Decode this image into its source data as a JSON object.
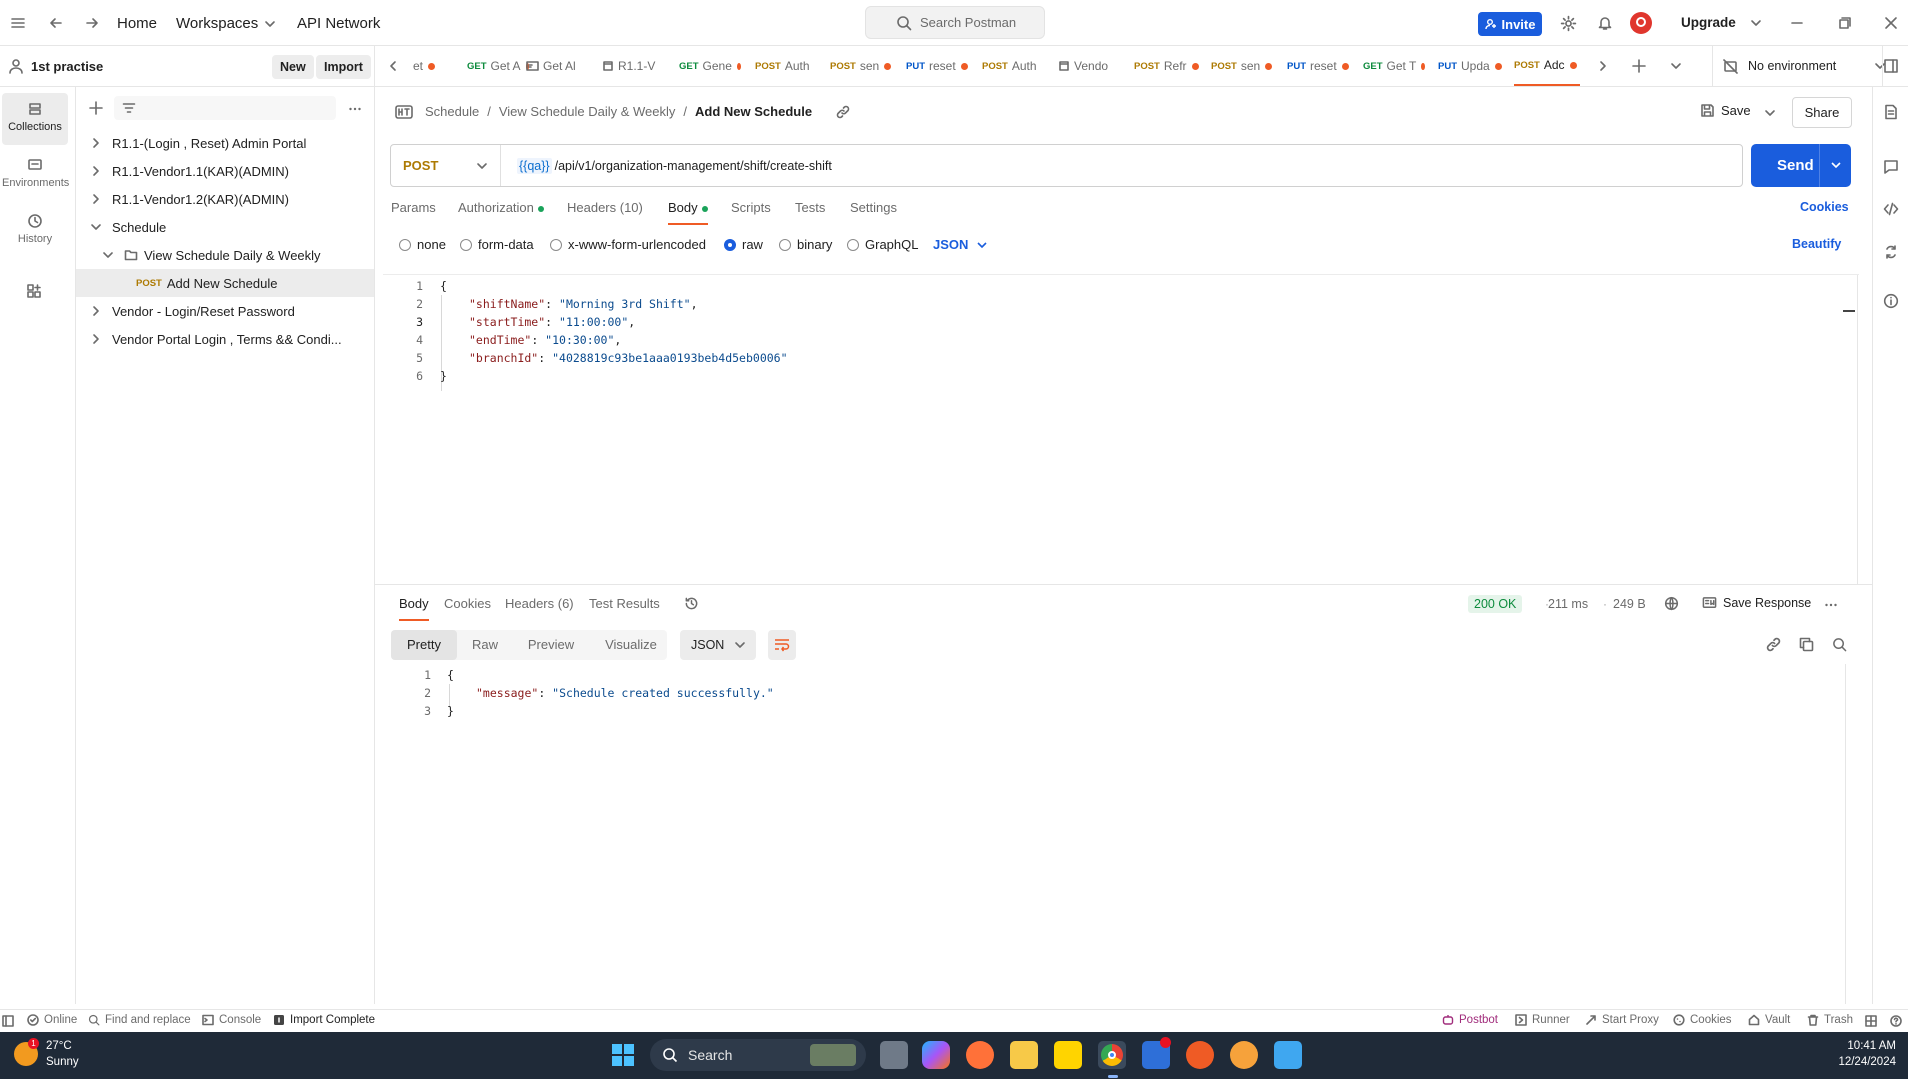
{
  "topbar": {
    "home": "Home",
    "workspaces": "Workspaces",
    "api_network": "API Network",
    "search_placeholder": "Search Postman",
    "invite": "Invite",
    "upgrade": "Upgrade"
  },
  "workspace": {
    "name": "1st practise",
    "new_label": "New",
    "import_label": "Import"
  },
  "rail": {
    "items": [
      {
        "label": "Collections",
        "icon": "collections-icon"
      },
      {
        "label": "Environments",
        "icon": "environments-icon"
      },
      {
        "label": "History",
        "icon": "history-icon"
      }
    ]
  },
  "sidebar": {
    "items": [
      {
        "label": "R1.1-(Login , Reset) Admin Portal"
      },
      {
        "label": "R1.1-Vendor1.1(KAR)(ADMIN)"
      },
      {
        "label": "R1.1-Vendor1.2(KAR)(ADMIN)"
      },
      {
        "label": "Schedule"
      },
      {
        "label": "View Schedule Daily & Weekly"
      },
      {
        "label": "Add New Schedule",
        "method": "POST"
      },
      {
        "label": "Vendor - Login/Reset Password"
      },
      {
        "label": "Vendor Portal Login , Terms && Condi..."
      }
    ]
  },
  "tabs": [
    {
      "method": "",
      "label": "et"
    },
    {
      "method": "GET",
      "label": "Get A"
    },
    {
      "method": "",
      "label": "Get Al"
    },
    {
      "method": "",
      "label": "R1.1-V"
    },
    {
      "method": "GET",
      "label": "Gene"
    },
    {
      "method": "POST",
      "label": "Auth"
    },
    {
      "method": "POST",
      "label": "sen"
    },
    {
      "method": "PUT",
      "label": "reset"
    },
    {
      "method": "POST",
      "label": "Auth"
    },
    {
      "method": "",
      "label": "Vendo"
    },
    {
      "method": "POST",
      "label": "Refr"
    },
    {
      "method": "POST",
      "label": "sen"
    },
    {
      "method": "PUT",
      "label": "reset"
    },
    {
      "method": "GET",
      "label": "Get T"
    },
    {
      "method": "PUT",
      "label": "Upda"
    },
    {
      "method": "POST",
      "label": "Adc"
    }
  ],
  "environment": "No environment",
  "breadcrumb": {
    "part1": "Schedule",
    "part2": "View Schedule Daily & Weekly",
    "current": "Add New Schedule"
  },
  "actions": {
    "save": "Save",
    "share": "Share"
  },
  "request": {
    "method": "POST",
    "url_var": "{{qa}}",
    "url_path": "/api/v1/organization-management/shift/create-shift",
    "send": "Send"
  },
  "request_tabs": {
    "params": "Params",
    "authorization": "Authorization",
    "headers": "Headers (10)",
    "body": "Body",
    "scripts": "Scripts",
    "tests": "Tests",
    "settings": "Settings",
    "cookies": "Cookies"
  },
  "body_types": {
    "none": "none",
    "form_data": "form-data",
    "urlencoded": "x-www-form-urlencoded",
    "raw": "raw",
    "binary": "binary",
    "graphql": "GraphQL",
    "format": "JSON",
    "beautify": "Beautify"
  },
  "request_body": {
    "line_numbers": [
      "1",
      "2",
      "3",
      "4",
      "5",
      "6"
    ],
    "open": "{",
    "close": "}",
    "k1": "\"shiftName\"",
    "v1": "\"Morning 3rd Shift\"",
    "k2": "\"startTime\"",
    "v2": "\"11:00:00\"",
    "k3": "\"endTime\"",
    "v3": "\"10:30:00\"",
    "k4": "\"branchId\"",
    "v4": "\"4028819c93be1aaa0193beb4d5eb0006\""
  },
  "response_tabs": {
    "body": "Body",
    "cookies": "Cookies",
    "headers": "Headers (6)",
    "test_results": "Test Results",
    "status": "200 OK",
    "time": "211 ms",
    "size": "249 B",
    "save_response": "Save Response"
  },
  "response_view": {
    "pretty": "Pretty",
    "raw": "Raw",
    "preview": "Preview",
    "visualize": "Visualize",
    "format": "JSON"
  },
  "response_body": {
    "line_numbers": [
      "1",
      "2",
      "3"
    ],
    "open": "{",
    "close": "}",
    "key": "\"message\"",
    "value": "\"Schedule created successfully.\""
  },
  "statusbar": {
    "online": "Online",
    "find_replace": "Find and replace",
    "console": "Console",
    "import_complete": "Import Complete",
    "postbot": "Postbot",
    "runner": "Runner",
    "start_proxy": "Start Proxy",
    "cookies": "Cookies",
    "vault": "Vault",
    "trash": "Trash"
  },
  "taskbar": {
    "temp": "27°C",
    "weather": "Sunny",
    "search": "Search",
    "time": "10:41 AM",
    "date": "12/24/2024"
  }
}
